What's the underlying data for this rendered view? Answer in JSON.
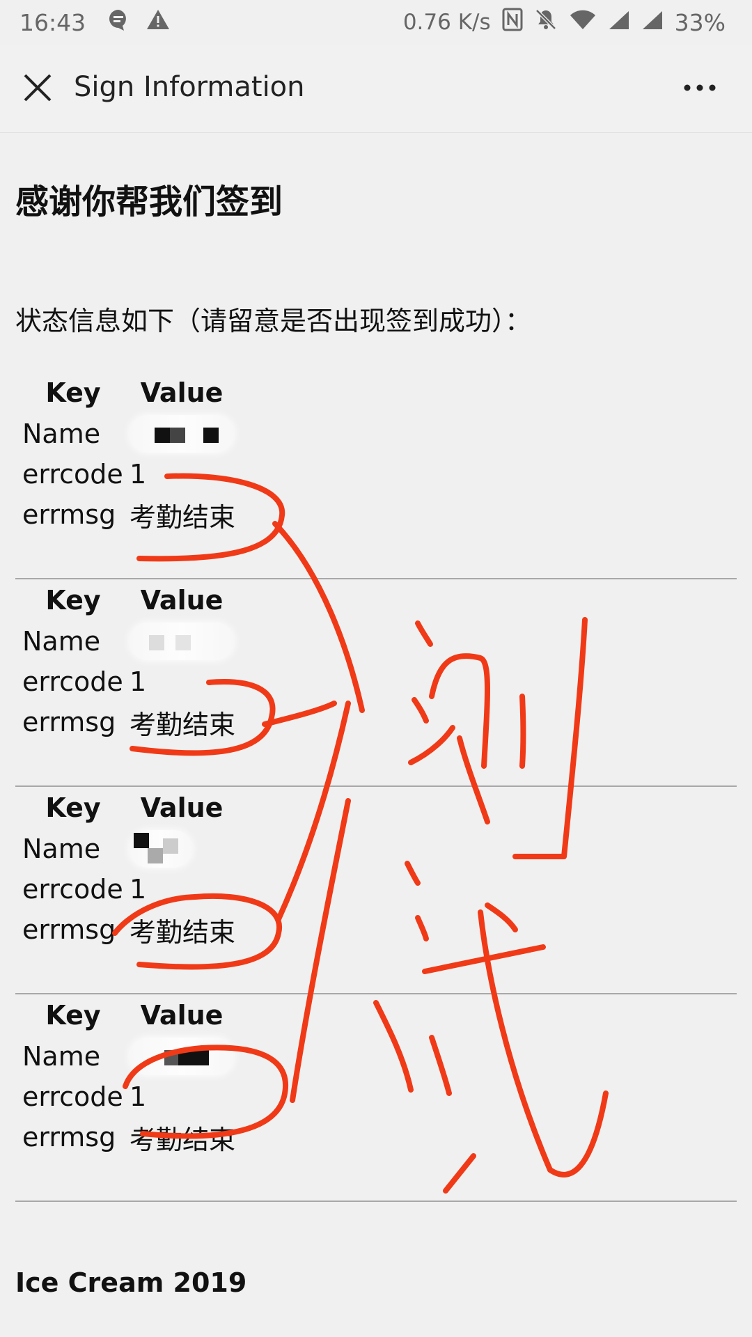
{
  "status_bar": {
    "time": "16:43",
    "net_speed": "0.76 K/s",
    "battery": "33%",
    "icons_left": [
      "chat-notification-icon",
      "warning-icon"
    ],
    "icons_right": [
      "nfc-icon",
      "mute-icon",
      "wifi-icon",
      "signal-icon",
      "signal-icon"
    ]
  },
  "app_bar": {
    "title": "Sign Information",
    "close_icon": "close-icon",
    "more_icon": "more-icon"
  },
  "page": {
    "heading": "感谢你帮我们签到",
    "status_line": "状态信息如下（请留意是否出现签到成功）：",
    "table_headers": {
      "key": "Key",
      "value": "Value"
    },
    "records": [
      {
        "name_label": "Name",
        "errcode_label": "errcode",
        "errcode": "1",
        "errmsg_label": "errmsg",
        "errmsg": "考勤结束"
      },
      {
        "name_label": "Name",
        "errcode_label": "errcode",
        "errcode": "1",
        "errmsg_label": "errmsg",
        "errmsg": "考勤结束"
      },
      {
        "name_label": "Name",
        "errcode_label": "errcode",
        "errcode": "1",
        "errmsg_label": "errmsg",
        "errmsg": "考勤结束"
      },
      {
        "name_label": "Name",
        "errcode_label": "errcode",
        "errcode": "1",
        "errmsg_label": "errmsg",
        "errmsg": "考勤结束"
      }
    ],
    "footer": "Ice Cream 2019"
  },
  "annotation": {
    "handwritten_text": "测试",
    "ink_color": "#f03a17"
  }
}
